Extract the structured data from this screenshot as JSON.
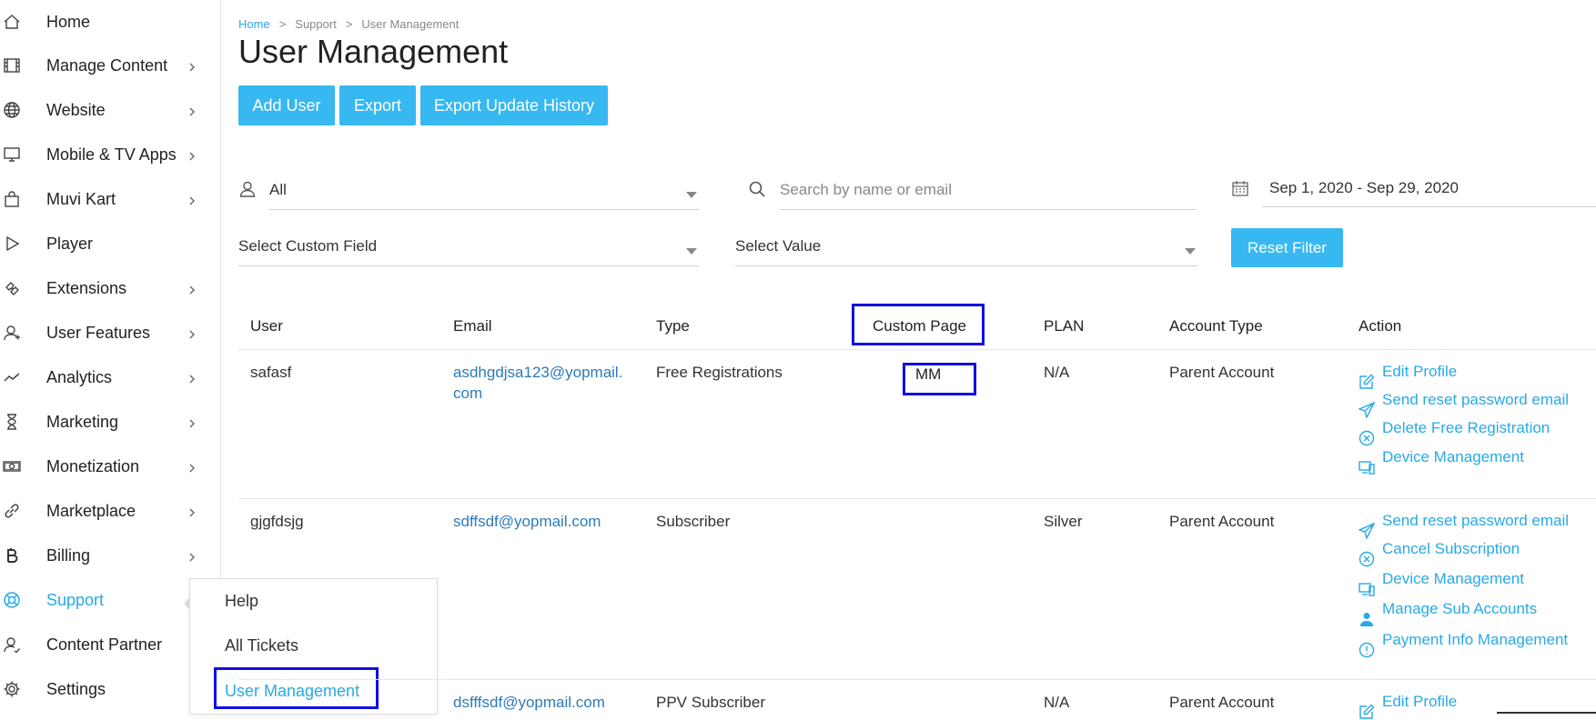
{
  "sidebar": {
    "items": [
      {
        "label": "Home",
        "icon": "home-icon",
        "chevron": false
      },
      {
        "label": "Manage Content",
        "icon": "film-icon",
        "chevron": true
      },
      {
        "label": "Website",
        "icon": "globe-icon",
        "chevron": true
      },
      {
        "label": "Mobile & TV Apps",
        "icon": "monitor-icon",
        "chevron": true
      },
      {
        "label": "Muvi Kart",
        "icon": "shopping-bag-icon",
        "chevron": true
      },
      {
        "label": "Player",
        "icon": "play-icon",
        "chevron": false
      },
      {
        "label": "Extensions",
        "icon": "puzzle-icon",
        "chevron": true
      },
      {
        "label": "User Features",
        "icon": "user-plus-icon",
        "chevron": true
      },
      {
        "label": "Analytics",
        "icon": "trend-icon",
        "chevron": true
      },
      {
        "label": "Marketing",
        "icon": "hourglass-icon",
        "chevron": true
      },
      {
        "label": "Monetization",
        "icon": "money-icon",
        "chevron": true
      },
      {
        "label": "Marketplace",
        "icon": "link-icon",
        "chevron": true
      },
      {
        "label": "Billing",
        "icon": "bitcoin-icon",
        "chevron": true
      },
      {
        "label": "Support",
        "icon": "lifebuoy-icon",
        "chevron": false
      },
      {
        "label": "Content Partner",
        "icon": "partner-icon",
        "chevron": false
      },
      {
        "label": "Settings",
        "icon": "gear-icon",
        "chevron": false
      }
    ]
  },
  "flyout": {
    "items": [
      "Help",
      "All Tickets",
      "User Management"
    ]
  },
  "breadcrumb": {
    "home": "Home",
    "sep1": ">",
    "support": "Support",
    "sep2": ">",
    "current": "User Management"
  },
  "page": {
    "title": "User Management"
  },
  "toolbar": {
    "add_user": "Add User",
    "export": "Export",
    "export_history": "Export Update History"
  },
  "filters": {
    "user_type": "All",
    "search_placeholder": "Search by name or email",
    "date_range": "Sep 1, 2020 - Sep 29, 2020",
    "custom_field": "Select Custom Field",
    "value": "Select Value",
    "reset": "Reset Filter"
  },
  "table": {
    "headers": {
      "user": "User",
      "email": "Email",
      "type": "Type",
      "custom_page": "Custom Page",
      "plan": "PLAN",
      "account_type": "Account Type",
      "action": "Action"
    },
    "rows": [
      {
        "user": "safasf",
        "email_line1": "asdhgdjsa123@yopmail.",
        "email_line2": "com",
        "type": "Free Registrations",
        "custom_page": "MM",
        "plan": "N/A",
        "account_type": "Parent Account",
        "actions": [
          "Edit Profile",
          "Send reset password email",
          "Delete Free Registration",
          "Device Management"
        ]
      },
      {
        "user": "gjgfdsjg",
        "email_line1": "sdffsdf@yopmail.com",
        "type": "Subscriber",
        "plan": "Silver",
        "account_type": "Parent Account",
        "actions": [
          "Send reset password email",
          "Cancel Subscription",
          "Device Management",
          "Manage Sub Accounts",
          "Payment Info Management"
        ]
      },
      {
        "email_line1": "dsfffsdf@yopmail.com",
        "type": "PPV Subscriber",
        "plan": "N/A",
        "account_type": "Parent Account",
        "actions": [
          "Edit Profile"
        ]
      }
    ]
  },
  "colors": {
    "accent": "#29a9e6",
    "button": "#37b8f0",
    "highlight": "#1010e0",
    "email": "#2e7bb8"
  }
}
